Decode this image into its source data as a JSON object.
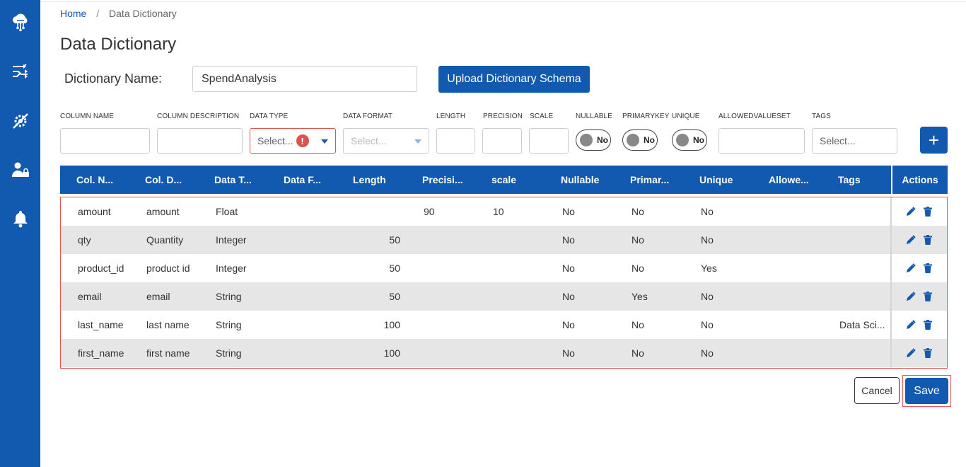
{
  "sidebar": {
    "items": [
      {
        "icon": "cloud-network-icon"
      },
      {
        "icon": "flow-arrows-icon"
      },
      {
        "icon": "gear-tools-icon"
      },
      {
        "icon": "user-lock-icon"
      },
      {
        "icon": "bell-icon"
      }
    ]
  },
  "breadcrumb": {
    "home": "Home",
    "separator": "/",
    "current": "Data Dictionary"
  },
  "page_title": "Data Dictionary",
  "dictionary": {
    "label": "Dictionary Name:",
    "value": "SpendAnalysis",
    "upload_label": "Upload Dictionary Schema"
  },
  "form": {
    "labels": {
      "column_name": "COLUMN NAME",
      "column_description": "COLUMN DESCRIPTION",
      "data_type": "DATA TYPE",
      "data_format": "DATA FORMAT",
      "length": "LENGTH",
      "precision": "PRECISION",
      "scale": "SCALE",
      "nullable": "NULLABLE",
      "primarykey": "PRIMARYKEY",
      "unique": "UNIQUE",
      "allowedvalueset": "ALLOWEDVALUESET",
      "tags": "TAGS"
    },
    "data_type_placeholder": "Select...",
    "data_type_error": "!",
    "data_format_placeholder": "Select...",
    "tags_placeholder": "Select...",
    "nullable_toggle": "No",
    "primarykey_toggle": "No",
    "unique_toggle": "No",
    "add_label": "+"
  },
  "table": {
    "headers": [
      "Col. N...",
      "Col. D...",
      "Data T...",
      "Data F...",
      "Length",
      "Precisi...",
      "scale",
      "Nullable",
      "Primar...",
      "Unique",
      "Allowe...",
      "Tags"
    ],
    "actions_header": "Actions",
    "rows": [
      {
        "name": "amount",
        "desc": "amount",
        "type": "Float",
        "format": "",
        "length": "",
        "precision": "90",
        "scale": "10",
        "nullable": "No",
        "primary": "No",
        "unique": "No",
        "allowed": "",
        "tags": ""
      },
      {
        "name": "qty",
        "desc": "Quantity",
        "type": "Integer",
        "format": "",
        "length": "50",
        "precision": "",
        "scale": "",
        "nullable": "No",
        "primary": "No",
        "unique": "No",
        "allowed": "",
        "tags": ""
      },
      {
        "name": "product_id",
        "desc": "product id",
        "type": "Integer",
        "format": "",
        "length": "50",
        "precision": "",
        "scale": "",
        "nullable": "No",
        "primary": "No",
        "unique": "Yes",
        "allowed": "",
        "tags": ""
      },
      {
        "name": "email",
        "desc": "email",
        "type": "String",
        "format": "",
        "length": "50",
        "precision": "",
        "scale": "",
        "nullable": "No",
        "primary": "Yes",
        "unique": "No",
        "allowed": "",
        "tags": ""
      },
      {
        "name": "last_name",
        "desc": "last name",
        "type": "String",
        "format": "",
        "length": "100",
        "precision": "",
        "scale": "",
        "nullable": "No",
        "primary": "No",
        "unique": "No",
        "allowed": "",
        "tags": "Data Sci..."
      },
      {
        "name": "first_name",
        "desc": "first name",
        "type": "String",
        "format": "",
        "length": "100",
        "precision": "",
        "scale": "",
        "nullable": "No",
        "primary": "No",
        "unique": "No",
        "allowed": "",
        "tags": ""
      }
    ]
  },
  "footer": {
    "cancel_label": "Cancel",
    "save_label": "Save"
  },
  "colors": {
    "primary": "#1259b0",
    "error": "#d9534f",
    "highlight": "#e05a5a",
    "row_alt": "#e6e6e6"
  }
}
